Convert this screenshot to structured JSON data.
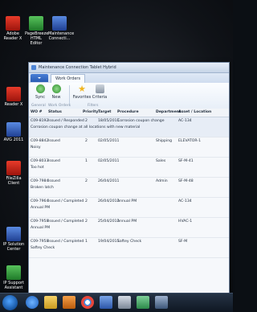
{
  "desktop": {
    "icons": [
      {
        "label": "Adobe Reader X",
        "icon": "adobe-reader-icon"
      },
      {
        "label": "PageBreeze HTML Editor",
        "icon": "pagebreeze-icon"
      },
      {
        "label": "Maintenance Connecti...",
        "icon": "maintenance-connection-icon"
      },
      {
        "label": "Reader X",
        "icon": "adobe-reader-icon"
      },
      {
        "label": "AVG 2011",
        "icon": "avg-icon"
      },
      {
        "label": "FileZilla Client",
        "icon": "filezilla-icon"
      },
      {
        "label": "IP Solution Center",
        "icon": "ip-solution-icon"
      },
      {
        "label": "IP Support Assistant",
        "icon": "support-assistant-icon"
      }
    ]
  },
  "window": {
    "title": "Maintenance Connection Tablet Hybrid",
    "tab": "Work Orders",
    "ribbon": {
      "buttons": [
        {
          "label": "Sync",
          "icon": "sync-icon"
        },
        {
          "label": "New",
          "icon": "new-icon"
        },
        {
          "label": "Favorites",
          "icon": "star-icon"
        },
        {
          "label": "Criteria",
          "icon": "criteria-icon"
        }
      ],
      "groups": [
        "General",
        "Work Orders",
        "Filters"
      ]
    },
    "table": {
      "columns": [
        "WO #",
        "Status",
        "Priority",
        "Target",
        "Procedure",
        "Department",
        "Asset / Location"
      ],
      "rows": [
        {
          "wo": "C09-8192",
          "status": "Issued / Responded",
          "priority": "2",
          "target": "18/05/2011",
          "procedure": "Corrosion coupon change",
          "department": "",
          "asset": "AC-134",
          "note": "Corrosion coupon change at all locations with new material"
        },
        {
          "wo": "C09-8842",
          "status": "Issued",
          "priority": "2",
          "target": "02/05/2011",
          "procedure": "",
          "department": "Shipping",
          "asset": "ELEVATOR-1",
          "note": "Noisy"
        },
        {
          "wo": "C09-8033",
          "status": "Issued",
          "priority": "1",
          "target": "02/05/2011",
          "procedure": "",
          "department": "Sales",
          "asset": "SF-M-41",
          "note": "Too hot"
        },
        {
          "wo": "C09-7984",
          "status": "Issued",
          "priority": "2",
          "target": "26/04/2011",
          "procedure": "",
          "department": "Admin",
          "asset": "SF-M-48",
          "note": "Broken latch"
        },
        {
          "wo": "C09-7964",
          "status": "Issued / Completed",
          "priority": "2",
          "target": "26/04/2011",
          "procedure": "Annual PM",
          "department": "",
          "asset": "AC-134",
          "note": "Annual PM"
        },
        {
          "wo": "C09-7958",
          "status": "Issued / Completed",
          "priority": "2",
          "target": "25/04/2011",
          "procedure": "Annual PM",
          "department": "",
          "asset": "HVAC-1",
          "note": "Annual PM"
        },
        {
          "wo": "C09-7958",
          "status": "Issued / Completed",
          "priority": "1",
          "target": "19/04/2011",
          "procedure": "Saftey Check",
          "department": "",
          "asset": "SF-M",
          "note": "Saftey Check"
        }
      ]
    }
  },
  "taskbar": {
    "items": [
      "start-orb-icon",
      "ie-icon",
      "folder-icon",
      "media-icon",
      "chrome-icon",
      "app-icon",
      "app2-icon",
      "app3-icon"
    ]
  }
}
